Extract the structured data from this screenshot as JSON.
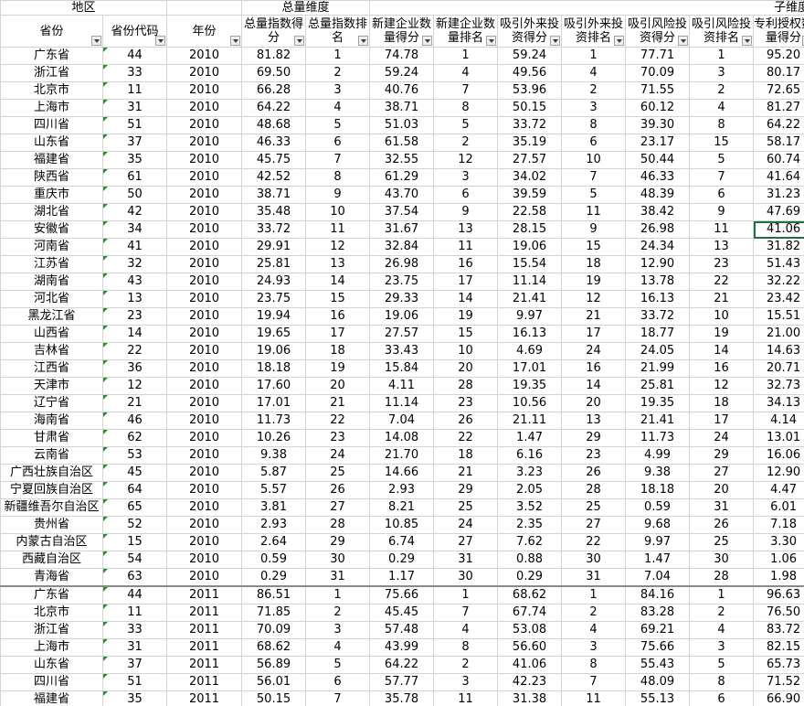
{
  "group_headers": {
    "region": "地区",
    "total_dimension": "总量维度",
    "sub_dimension": "子维度"
  },
  "columns": [
    {
      "label": "省份",
      "filter": true
    },
    {
      "label": "省份代码",
      "filter": true
    },
    {
      "label": "年份",
      "filter": true
    },
    {
      "label": "总量指数得分",
      "filter": true
    },
    {
      "label": "总量指数排名",
      "filter": true
    },
    {
      "label": "新建企业数量得分",
      "filter": true
    },
    {
      "label": "新建企业数量排名",
      "filter": true
    },
    {
      "label": "吸引外来投资得分",
      "filter": true
    },
    {
      "label": "吸引外来投资排名",
      "filter": true
    },
    {
      "label": "吸引风险投资得分",
      "filter": true
    },
    {
      "label": "吸引风险投资排名",
      "filter": true
    },
    {
      "label": "专利授权数量得分",
      "filter": true
    }
  ],
  "rows": [
    [
      "广东省",
      "44",
      "2010",
      "81.82",
      "1",
      "74.78",
      "1",
      "59.24",
      "1",
      "77.71",
      "1",
      "95.20"
    ],
    [
      "浙江省",
      "33",
      "2010",
      "69.50",
      "2",
      "59.24",
      "4",
      "49.56",
      "4",
      "70.09",
      "3",
      "80.17"
    ],
    [
      "北京市",
      "11",
      "2010",
      "66.28",
      "3",
      "40.76",
      "7",
      "53.96",
      "2",
      "71.55",
      "2",
      "72.65"
    ],
    [
      "上海市",
      "31",
      "2010",
      "64.22",
      "4",
      "38.71",
      "8",
      "50.15",
      "3",
      "60.12",
      "4",
      "81.27"
    ],
    [
      "四川省",
      "51",
      "2010",
      "48.68",
      "5",
      "51.03",
      "5",
      "33.72",
      "8",
      "39.30",
      "8",
      "64.22"
    ],
    [
      "山东省",
      "37",
      "2010",
      "46.33",
      "6",
      "61.58",
      "2",
      "35.19",
      "6",
      "23.17",
      "15",
      "58.17"
    ],
    [
      "福建省",
      "35",
      "2010",
      "45.75",
      "7",
      "32.55",
      "12",
      "27.57",
      "10",
      "50.44",
      "5",
      "60.74"
    ],
    [
      "陕西省",
      "61",
      "2010",
      "42.52",
      "8",
      "61.29",
      "3",
      "34.02",
      "7",
      "46.33",
      "7",
      "41.64"
    ],
    [
      "重庆市",
      "50",
      "2010",
      "38.71",
      "9",
      "43.70",
      "6",
      "39.59",
      "5",
      "48.39",
      "6",
      "31.23"
    ],
    [
      "湖北省",
      "42",
      "2010",
      "35.48",
      "10",
      "37.54",
      "9",
      "22.58",
      "11",
      "38.42",
      "9",
      "47.69"
    ],
    [
      "安徽省",
      "34",
      "2010",
      "33.72",
      "11",
      "31.67",
      "13",
      "28.15",
      "9",
      "26.98",
      "11",
      "41.06"
    ],
    [
      "河南省",
      "41",
      "2010",
      "29.91",
      "12",
      "32.84",
      "11",
      "19.06",
      "15",
      "24.34",
      "13",
      "31.82"
    ],
    [
      "江苏省",
      "32",
      "2010",
      "25.81",
      "13",
      "26.98",
      "16",
      "15.54",
      "18",
      "12.90",
      "23",
      "51.43"
    ],
    [
      "湖南省",
      "43",
      "2010",
      "24.93",
      "14",
      "23.75",
      "17",
      "11.14",
      "19",
      "13.78",
      "22",
      "32.22"
    ],
    [
      "河北省",
      "13",
      "2010",
      "23.75",
      "15",
      "29.33",
      "14",
      "21.41",
      "12",
      "16.13",
      "21",
      "23.42"
    ],
    [
      "黑龙江省",
      "23",
      "2010",
      "19.94",
      "16",
      "19.06",
      "19",
      "9.97",
      "21",
      "33.72",
      "10",
      "15.51"
    ],
    [
      "山西省",
      "14",
      "2010",
      "19.65",
      "17",
      "27.57",
      "15",
      "16.13",
      "17",
      "18.77",
      "19",
      "21.00"
    ],
    [
      "吉林省",
      "22",
      "2010",
      "19.06",
      "18",
      "33.43",
      "10",
      "4.69",
      "24",
      "24.05",
      "14",
      "14.63"
    ],
    [
      "江西省",
      "36",
      "2010",
      "18.18",
      "19",
      "15.84",
      "20",
      "17.01",
      "16",
      "21.99",
      "16",
      "20.71"
    ],
    [
      "天津市",
      "12",
      "2010",
      "17.60",
      "20",
      "4.11",
      "28",
      "19.35",
      "14",
      "25.81",
      "12",
      "32.73"
    ],
    [
      "辽宁省",
      "21",
      "2010",
      "17.01",
      "21",
      "11.14",
      "23",
      "10.56",
      "20",
      "19.35",
      "18",
      "34.13"
    ],
    [
      "海南省",
      "46",
      "2010",
      "11.73",
      "22",
      "7.04",
      "26",
      "21.11",
      "13",
      "21.41",
      "17",
      "4.14"
    ],
    [
      "甘肃省",
      "62",
      "2010",
      "10.26",
      "23",
      "14.08",
      "22",
      "1.47",
      "29",
      "11.73",
      "24",
      "13.01"
    ],
    [
      "云南省",
      "53",
      "2010",
      "9.38",
      "24",
      "21.70",
      "18",
      "6.16",
      "23",
      "4.99",
      "29",
      "16.06"
    ],
    [
      "广西壮族自治区",
      "45",
      "2010",
      "5.87",
      "25",
      "14.66",
      "21",
      "3.23",
      "26",
      "9.38",
      "27",
      "12.90"
    ],
    [
      "宁夏回族自治区",
      "64",
      "2010",
      "5.57",
      "26",
      "2.93",
      "29",
      "2.05",
      "28",
      "18.18",
      "20",
      "4.47"
    ],
    [
      "新疆维吾尔自治区",
      "65",
      "2010",
      "3.81",
      "27",
      "8.21",
      "25",
      "3.52",
      "25",
      "0.59",
      "31",
      "6.01"
    ],
    [
      "贵州省",
      "52",
      "2010",
      "2.93",
      "28",
      "10.85",
      "24",
      "2.35",
      "27",
      "9.68",
      "26",
      "7.18"
    ],
    [
      "内蒙古自治区",
      "15",
      "2010",
      "2.64",
      "29",
      "6.74",
      "27",
      "7.62",
      "22",
      "9.97",
      "25",
      "3.30"
    ],
    [
      "西藏自治区",
      "54",
      "2010",
      "0.59",
      "30",
      "0.29",
      "31",
      "0.88",
      "30",
      "1.47",
      "30",
      "1.06"
    ],
    [
      "青海省",
      "63",
      "2010",
      "0.29",
      "31",
      "1.17",
      "30",
      "0.29",
      "31",
      "7.04",
      "28",
      "1.98"
    ],
    [
      "广东省",
      "44",
      "2011",
      "86.51",
      "1",
      "75.66",
      "1",
      "68.62",
      "1",
      "84.16",
      "1",
      "96.63"
    ],
    [
      "北京市",
      "11",
      "2011",
      "71.85",
      "2",
      "45.45",
      "7",
      "67.74",
      "2",
      "83.28",
      "2",
      "76.50"
    ],
    [
      "浙江省",
      "33",
      "2011",
      "70.09",
      "3",
      "57.48",
      "4",
      "53.08",
      "4",
      "69.21",
      "4",
      "83.72"
    ],
    [
      "上海市",
      "31",
      "2011",
      "68.62",
      "4",
      "43.99",
      "8",
      "56.60",
      "3",
      "75.66",
      "3",
      "82.15"
    ],
    [
      "山东省",
      "37",
      "2011",
      "56.89",
      "5",
      "64.22",
      "2",
      "41.06",
      "8",
      "55.43",
      "5",
      "65.73"
    ],
    [
      "四川省",
      "51",
      "2011",
      "56.01",
      "6",
      "57.77",
      "3",
      "42.23",
      "7",
      "48.09",
      "8",
      "71.52"
    ],
    [
      "福建省",
      "35",
      "2011",
      "50.15",
      "7",
      "35.78",
      "11",
      "31.38",
      "11",
      "55.13",
      "6",
      "66.90"
    ]
  ],
  "selected_cell": {
    "row": 10,
    "col": 11
  }
}
